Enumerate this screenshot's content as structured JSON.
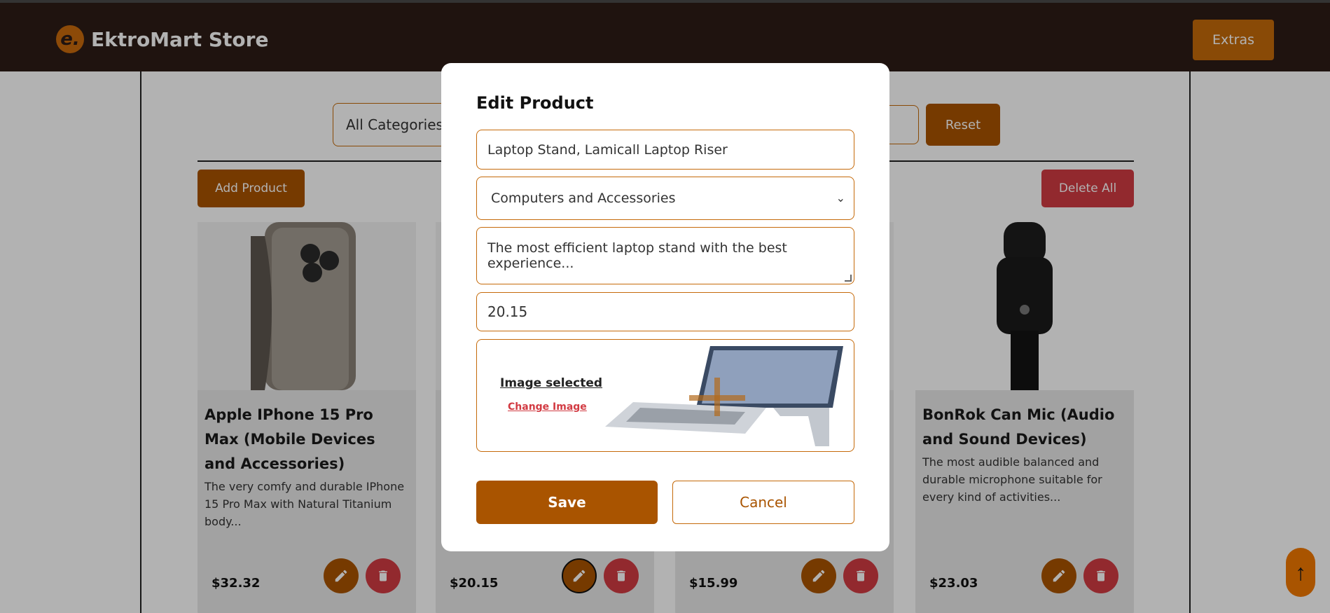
{
  "header": {
    "logo_letter": "e.",
    "brand": "EktroMart Store",
    "extras_label": "Extras"
  },
  "toolbar": {
    "category_filter": "All Categories",
    "reset_label": "Reset",
    "add_label": "Add Product",
    "delete_all_label": "Delete All"
  },
  "cards": [
    {
      "title": "Apple IPhone 15 Pro Max (Mobile Devices and Accessories)",
      "desc": "The very comfy and durable IPhone 15 Pro Max with Natural Titanium body...",
      "price": "$32.32"
    },
    {
      "title": "",
      "desc": "",
      "price": "$20.15"
    },
    {
      "title": "",
      "desc": "",
      "price": "$15.99"
    },
    {
      "title": "BonRok Can Mic (Audio and Sound Devices)",
      "desc": "The most audible balanced and durable microphone suitable for every kind of activities...",
      "price": "$23.03"
    }
  ],
  "modal": {
    "title": "Edit Product",
    "name_value": "Laptop Stand, Lamicall Laptop Riser",
    "category_value": "Computers and Accessories",
    "description_value": "The most efficient laptop stand with the best experience...",
    "price_value": "20.15",
    "image_status": "Image selected",
    "change_image_label": "Change Image",
    "save_label": "Save",
    "cancel_label": "Cancel"
  },
  "scroll_top_glyph": "↑",
  "colors": {
    "brand": "#a95400",
    "danger": "#d23b43",
    "header_bg": "#2d1c16"
  }
}
